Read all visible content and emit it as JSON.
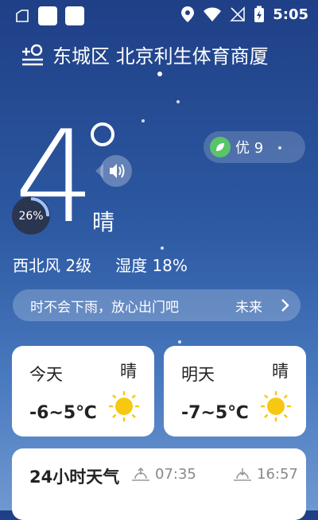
{
  "status_bar": {
    "time": "5:05"
  },
  "location": {
    "title": "东城区 北京利生体育商厦"
  },
  "current": {
    "temperature": "4",
    "condition": "晴",
    "wind": "西北风 2级",
    "humidity": "湿度 18%",
    "gauge_percent": "26%",
    "aqi_label": "优 9"
  },
  "banner": {
    "text": "时不会下雨，放心出门吧",
    "future_label": "未来"
  },
  "forecast": [
    {
      "day": "今天",
      "condition": "晴",
      "range": "-6~5℃"
    },
    {
      "day": "明天",
      "condition": "晴",
      "range": "-7~5℃"
    }
  ],
  "hourly": {
    "title": "24小时天气",
    "sunrise": "07:35",
    "sunset": "16:57"
  },
  "colors": {
    "leaf": "#59c46a",
    "sun": "#f7c811"
  }
}
